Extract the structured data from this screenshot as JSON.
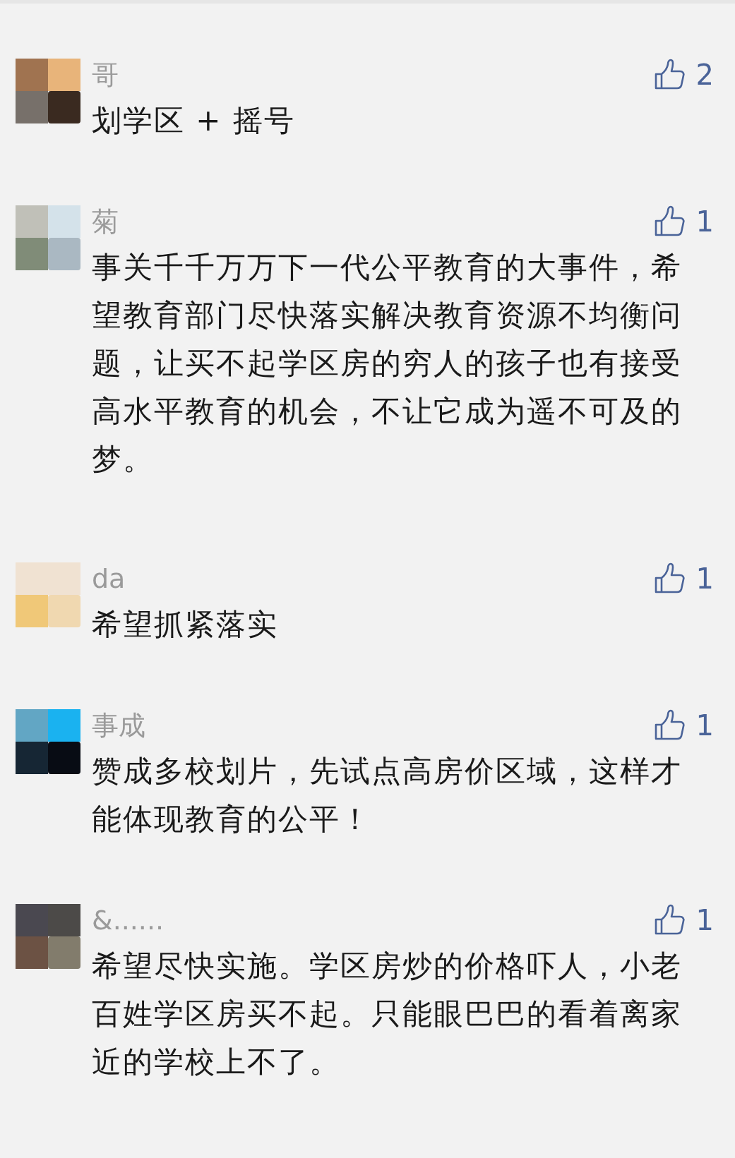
{
  "comments": [
    {
      "name": "哥",
      "likes": "2",
      "text": "划学区 + 摇号"
    },
    {
      "name": "菊",
      "likes": "1",
      "text": "事关千千万万下一代公平教育的大事件，希望教育部门尽快落实解决教育资源不均衡问题，让买不起学区房的穷人的孩子也有接受高水平教育的机会，不让它成为遥不可及的梦。"
    },
    {
      "name": "da",
      "likes": "1",
      "text": "希望抓紧落实"
    },
    {
      "name": "事成",
      "likes": "1",
      "text": "赞成多校划片，先试点高房价区域，这样才能体现教育的公平！"
    },
    {
      "name": "&......",
      "likes": "1",
      "text": "希望尽快实施。学区房炒的价格吓人，小老百姓学区房买不起。只能眼巴巴的看着离家近的学校上不了。"
    }
  ]
}
